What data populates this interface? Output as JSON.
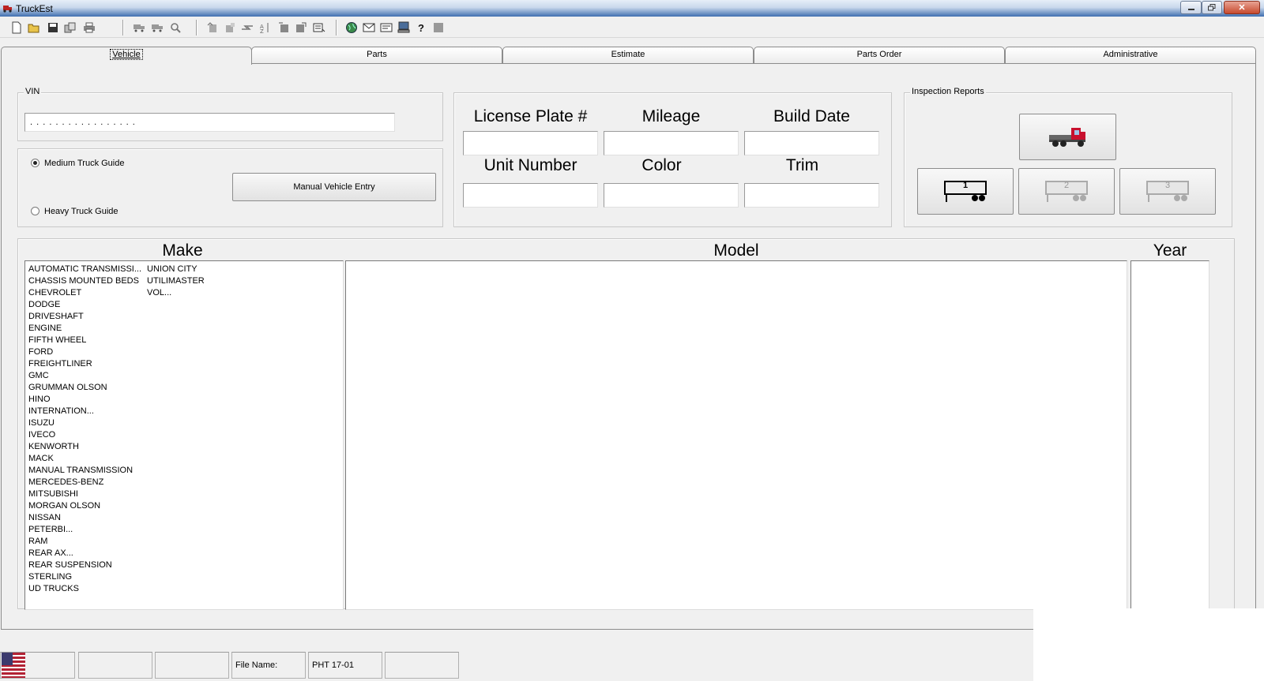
{
  "window": {
    "title": "TruckEst",
    "controls": [
      "minimize",
      "restore",
      "close"
    ]
  },
  "toolbar": {
    "icons": [
      "new-doc-icon",
      "open-folder-icon",
      "save-icon",
      "copy-icon",
      "print-icon",
      "truck-icon",
      "truck-copy-icon",
      "zoom-icon",
      "export-icon",
      "import-icon",
      "transfer-icon",
      "sort-icon",
      "left-panel-icon",
      "right-panel-icon",
      "calculator-icon",
      "globe-icon",
      "mail-icon",
      "card-icon",
      "computer-icon",
      "help-icon",
      "stop-icon"
    ]
  },
  "tabs": [
    {
      "label": "Vehicle",
      "active": true
    },
    {
      "label": "Parts",
      "active": false
    },
    {
      "label": "Estimate",
      "active": false
    },
    {
      "label": "Parts Order",
      "active": false
    },
    {
      "label": "Administrative",
      "active": false
    }
  ],
  "vin": {
    "label": "VIN",
    "value": ". . . . . . . . . . . . . . . . ."
  },
  "guide": {
    "medium": {
      "label": "Medium Truck Guide",
      "selected": true
    },
    "heavy": {
      "label": "Heavy Truck Guide",
      "selected": false
    },
    "manual_button": "Manual Vehicle Entry"
  },
  "vehicle_fields": {
    "license_plate": {
      "label": "License Plate #",
      "value": ""
    },
    "mileage": {
      "label": "Mileage",
      "value": ""
    },
    "build_date": {
      "label": "Build Date",
      "value": ""
    },
    "unit_number": {
      "label": "Unit Number",
      "value": ""
    },
    "color": {
      "label": "Color",
      "value": ""
    },
    "trim": {
      "label": "Trim",
      "value": ""
    }
  },
  "inspection": {
    "label": "Inspection Reports",
    "trailers": [
      "1",
      "2",
      "3"
    ]
  },
  "lists": {
    "make_label": "Make",
    "model_label": "Model",
    "year_label": "Year",
    "makes_col1": [
      "AUTOMATIC TRANSMISSI...",
      "CHASSIS MOUNTED BEDS",
      "CHEVROLET",
      "DODGE",
      "DRIVESHAFT",
      "ENGINE",
      "FIFTH WHEEL",
      "FORD",
      "FREIGHTLINER",
      "GMC",
      "GRUMMAN OLSON",
      "HINO",
      "INTERNATION...",
      "ISUZU",
      "IVECO",
      "KENWORTH",
      "MACK",
      "MANUAL TRANSMISSION",
      "MERCEDES-BENZ",
      "MITSUBISHI",
      "MORGAN OLSON",
      "NISSAN",
      "PETERBI...",
      "RAM",
      "REAR AX...",
      "REAR SUSPENSION",
      "STERLING",
      "UD TRUCKS"
    ],
    "makes_col2": [
      "UNION CITY",
      "UTILIMASTER",
      "VOL..."
    ]
  },
  "status": {
    "file_label": "File Name:",
    "file_value": "PHT 17-01"
  },
  "colors": {
    "titlebar": "#3f6fb0",
    "truck_red": "#c8102e"
  }
}
